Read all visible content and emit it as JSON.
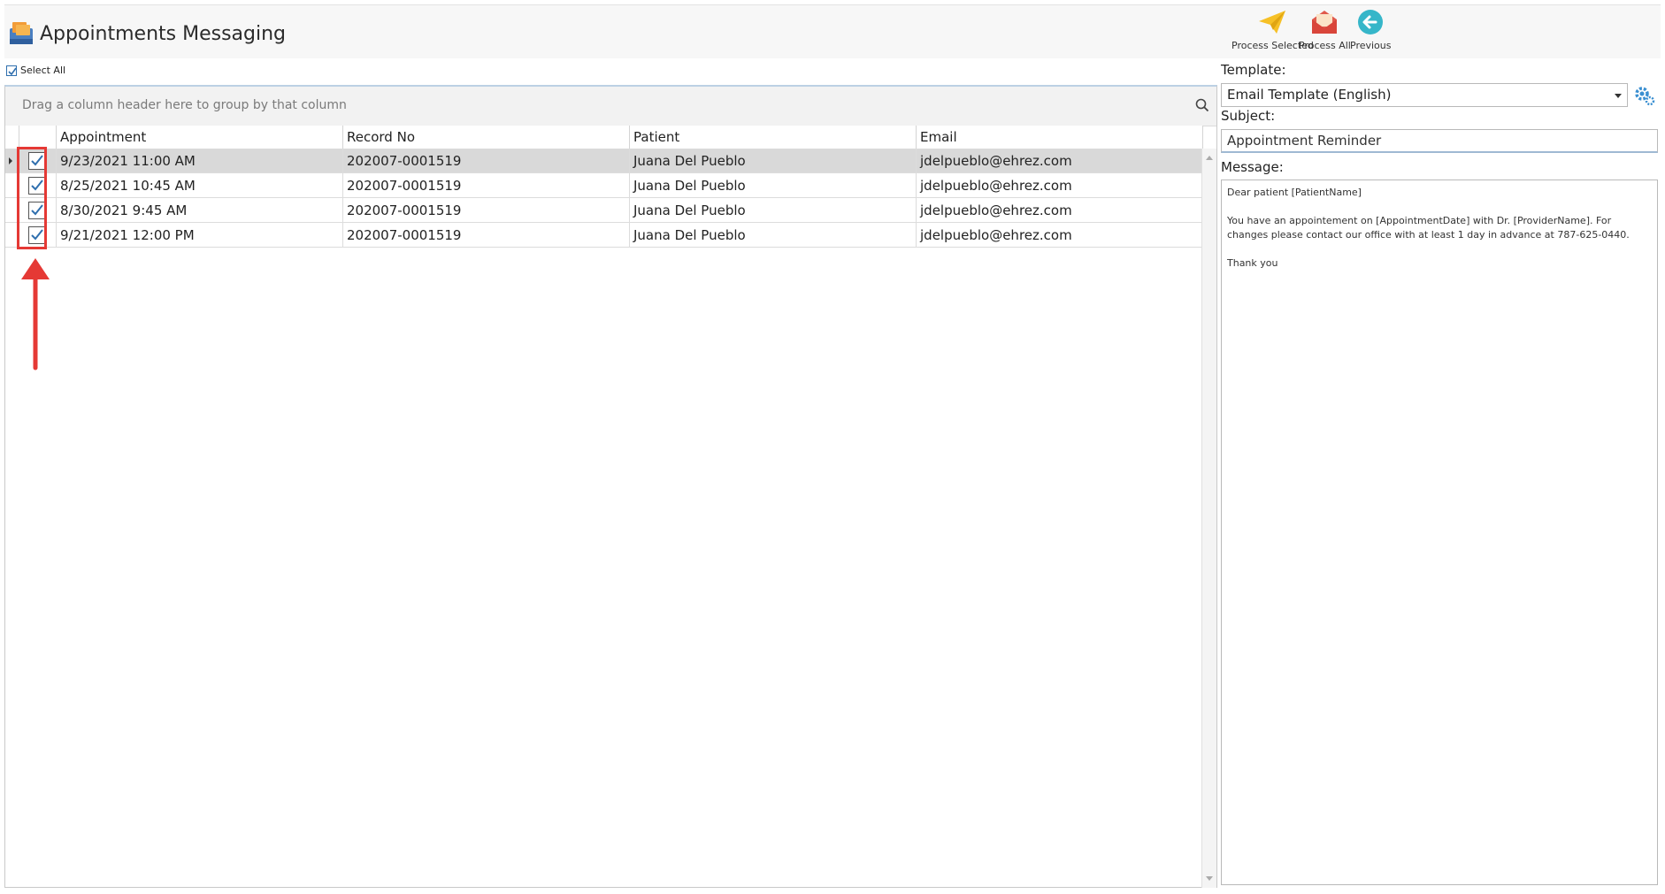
{
  "window": {
    "title": "Appointments Messaging"
  },
  "toolbar": {
    "process_selected_label": "Process Selected",
    "process_all_label": "Process All",
    "previous_label": "Previous"
  },
  "select_all": {
    "label": "Select All",
    "checked": true
  },
  "grid": {
    "group_hint": "Drag a column header here to group by that column",
    "columns": [
      "Appointment",
      "Record No",
      "Patient",
      "Email"
    ],
    "rows": [
      {
        "checked": true,
        "appointment": "9/23/2021 11:00 AM",
        "record_no": "202007-0001519",
        "patient": "Juana Del Pueblo",
        "email": "jdelpueblo@ehrez.com",
        "selected": true
      },
      {
        "checked": true,
        "appointment": "8/25/2021 10:45 AM",
        "record_no": "202007-0001519",
        "patient": "Juana Del Pueblo",
        "email": "jdelpueblo@ehrez.com",
        "selected": false
      },
      {
        "checked": true,
        "appointment": "8/30/2021 9:45 AM",
        "record_no": "202007-0001519",
        "patient": "Juana Del Pueblo",
        "email": "jdelpueblo@ehrez.com",
        "selected": false
      },
      {
        "checked": true,
        "appointment": "9/21/2021 12:00 PM",
        "record_no": "202007-0001519",
        "patient": "Juana Del Pueblo",
        "email": "jdelpueblo@ehrez.com",
        "selected": false
      }
    ]
  },
  "form": {
    "template_label": "Template:",
    "template_value": "Email Template (English)",
    "subject_label": "Subject:",
    "subject_value": "Appointment Reminder",
    "message_label": "Message:",
    "message_value": "Dear patient [PatientName]\n\nYou have an appointement on [AppointmentDate] with Dr. [ProviderName]. For changes please contact our office with at least 1 day in advance at 787-625-0440.\n\nThank you"
  },
  "colors": {
    "annotation_red": "#e53935",
    "selected_row": "#d9d9d9",
    "check_blue": "#2f6fae"
  }
}
